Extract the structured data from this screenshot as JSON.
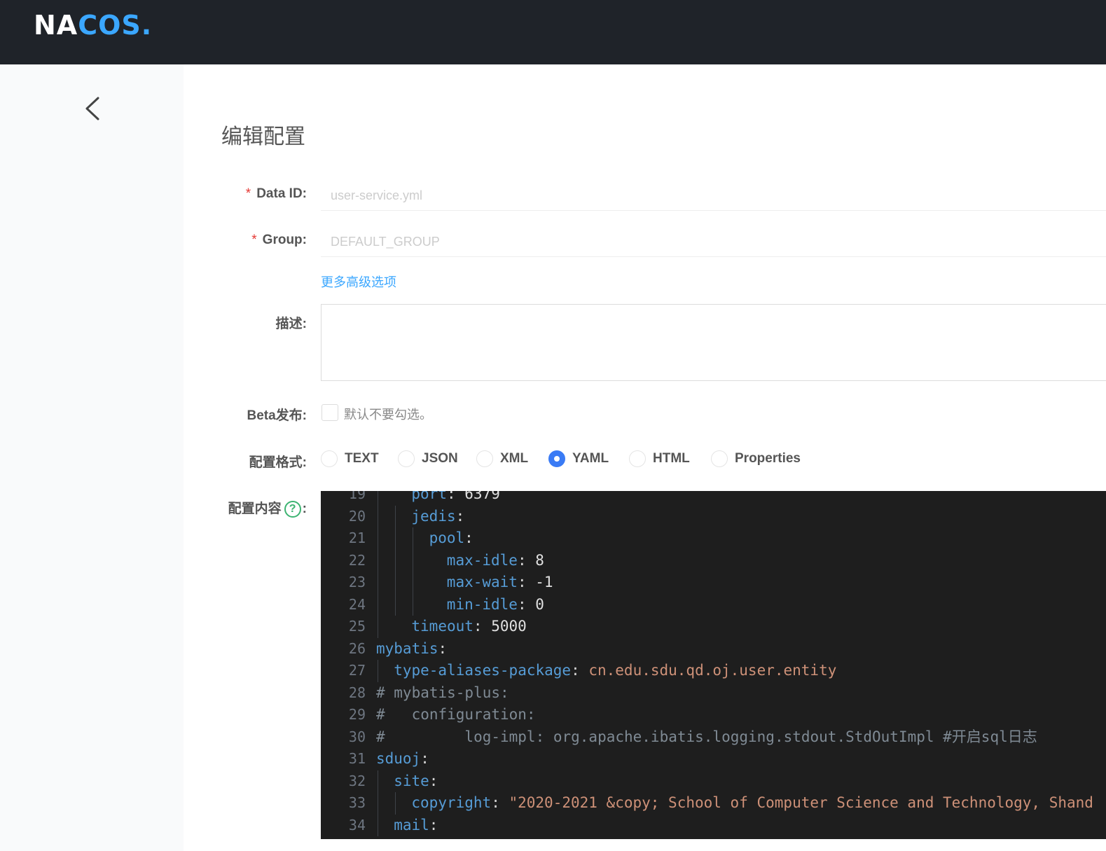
{
  "header": {
    "logo_text_1": "NA",
    "logo_text_2": "C",
    "logo_text_3": "OS",
    "logo_text_4": ".",
    "accent": "#3ba7ff",
    "bg": "#1f2329"
  },
  "page": {
    "title": "编辑配置"
  },
  "form": {
    "data_id_label": "Data ID:",
    "data_id_value": "user-service.yml",
    "group_label": "Group:",
    "group_value": "DEFAULT_GROUP",
    "required_mark": "*",
    "advanced_link": "更多高级选项",
    "description_label": "描述:",
    "description_value": "",
    "beta_label": "Beta发布:",
    "beta_hint": "默认不要勾选。",
    "format_label": "配置格式:",
    "formats": [
      {
        "label": "TEXT",
        "selected": false
      },
      {
        "label": "JSON",
        "selected": false
      },
      {
        "label": "XML",
        "selected": false
      },
      {
        "label": "YAML",
        "selected": true
      },
      {
        "label": "HTML",
        "selected": false
      },
      {
        "label": "Properties",
        "selected": false
      }
    ],
    "content_label": "配置内容",
    "content_colon": ":",
    "help_glyph": "?"
  },
  "editor": {
    "lines": [
      {
        "n": "19",
        "key": "port",
        "sep": ": ",
        "val": "6379",
        "indent": 2
      },
      {
        "n": "20",
        "key": "jedis",
        "sep": ":",
        "val": "",
        "indent": 2
      },
      {
        "n": "21",
        "key": "pool",
        "sep": ":",
        "val": "",
        "indent": 3
      },
      {
        "n": "22",
        "key": "max-idle",
        "sep": ": ",
        "val": "8",
        "indent": 4
      },
      {
        "n": "23",
        "key": "max-wait",
        "sep": ": ",
        "val": "-1",
        "indent": 4
      },
      {
        "n": "24",
        "key": "min-idle",
        "sep": ": ",
        "val": "0",
        "indent": 4
      },
      {
        "n": "25",
        "key": "timeout",
        "sep": ": ",
        "val": "5000",
        "indent": 2
      },
      {
        "n": "26",
        "key": "mybatis",
        "sep": ":",
        "val": "",
        "indent": 0
      },
      {
        "n": "27",
        "key": "type-aliases-package",
        "sep": ": ",
        "val": "cn.edu.sdu.qd.oj.user.entity",
        "indent": 1
      },
      {
        "n": "28",
        "comment": "# mybatis-plus:"
      },
      {
        "n": "29",
        "comment": "#   configuration:"
      },
      {
        "n": "30",
        "comment": "#         log-impl: org.apache.ibatis.logging.stdout.StdOutImpl #开启sql日志"
      },
      {
        "n": "31",
        "key": "sduoj",
        "sep": ":",
        "val": "",
        "indent": 0
      },
      {
        "n": "32",
        "key": "site",
        "sep": ":",
        "val": "",
        "indent": 1
      },
      {
        "n": "33",
        "key": "copyright",
        "sep": ": ",
        "val": "\"2020-2021 &copy; School of Computer Science and Technology, Shand",
        "indent": 2
      },
      {
        "n": "34",
        "key": "mail",
        "sep": ":",
        "val": "",
        "indent": 1
      }
    ]
  }
}
